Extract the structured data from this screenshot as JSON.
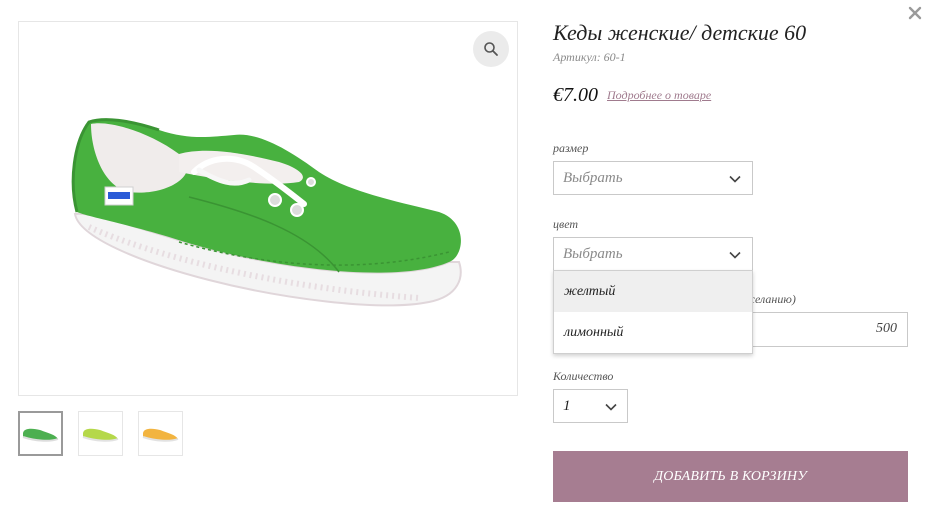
{
  "product": {
    "title": "Кеды женские/ детские 60",
    "sku": "Артикул: 60-1",
    "price": "€7.00",
    "details_link": "Подробнее о товаре"
  },
  "gallery": {
    "main_image": "green-canvas-sneaker",
    "thumbnails": [
      {
        "color": "#4caf50",
        "active": true
      },
      {
        "color": "#b5d84a",
        "active": false
      },
      {
        "color": "#f2b440",
        "active": false
      }
    ]
  },
  "options": {
    "size": {
      "label": "размер",
      "value": "Выбрать"
    },
    "color": {
      "label": "цвет",
      "value": "Выбрать",
      "dropdown_open": true,
      "options": [
        "желтый",
        "лимонный"
      ]
    },
    "extra": {
      "label_fragment": "желанию)",
      "value": "500"
    },
    "quantity": {
      "label": "Количество",
      "value": "1"
    }
  },
  "cart": {
    "add_button_label": "Добавить в корзину"
  },
  "colors": {
    "accent": "#a67d91",
    "link": "#a07b8e"
  }
}
